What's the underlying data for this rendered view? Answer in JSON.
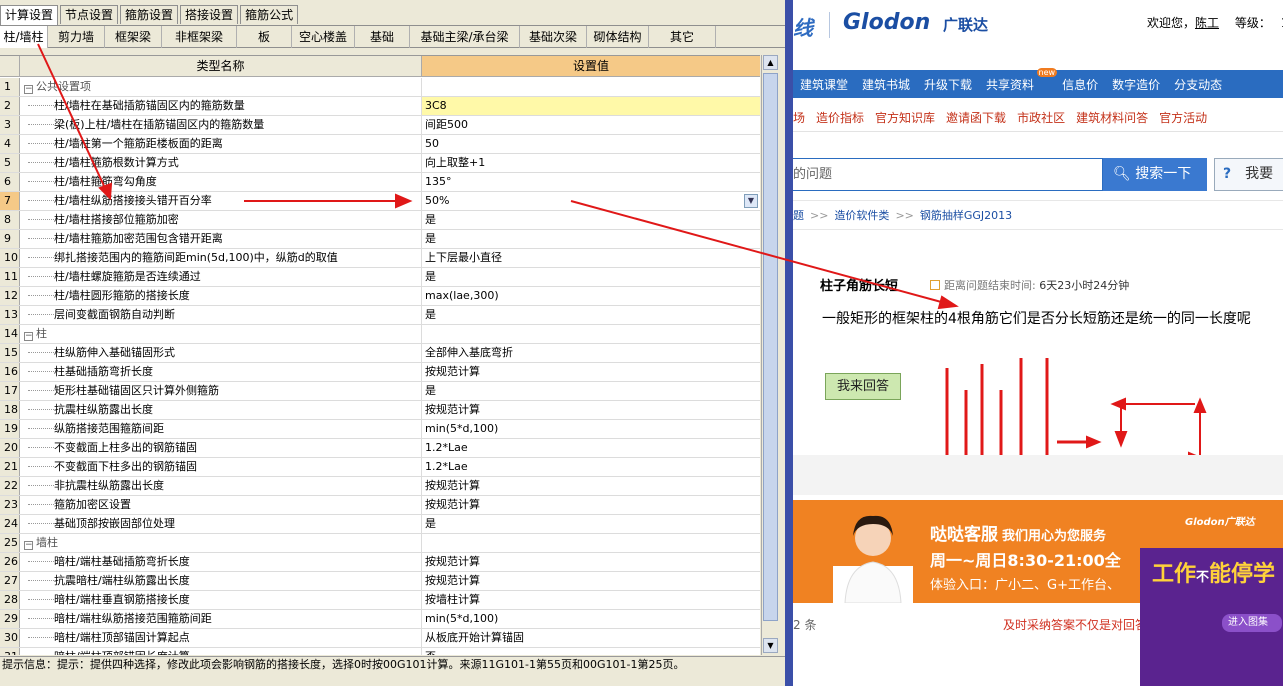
{
  "left": {
    "top_tabs": [
      "计算设置",
      "节点设置",
      "箍筋设置",
      "搭接设置",
      "箍筋公式"
    ],
    "active_top_tab": 0,
    "sub_tabs": [
      "柱/墙柱",
      "剪力墙",
      "框架梁",
      "非框架梁",
      "板",
      "空心楼盖",
      "基础",
      "基础主梁/承台梁",
      "基础次梁",
      "砌体结构",
      "其它"
    ],
    "active_sub_tab": 0,
    "grid": {
      "col_name": "类型名称",
      "col_value": "设置值",
      "rows": [
        {
          "num": "1",
          "name": "公共设置项",
          "value": "",
          "group": true
        },
        {
          "num": "2",
          "name": "柱/墙柱在基础插筋锚固区内的箍筋数量",
          "value": "3C8",
          "highlight": true
        },
        {
          "num": "3",
          "name": "梁(板)上柱/墙柱在插筋锚固区内的箍筋数量",
          "value": "间距500"
        },
        {
          "num": "4",
          "name": "柱/墙柱第一个箍筋距楼板面的距离",
          "value": "50"
        },
        {
          "num": "5",
          "name": "柱/墙柱箍筋根数计算方式",
          "value": "向上取整+1"
        },
        {
          "num": "6",
          "name": "柱/墙柱箍筋弯勾角度",
          "value": "135°"
        },
        {
          "num": "7",
          "name": "柱/墙柱纵筋搭接接头错开百分率",
          "value": "50%",
          "selected": true
        },
        {
          "num": "8",
          "name": "柱/墙柱搭接部位箍筋加密",
          "value": "是"
        },
        {
          "num": "9",
          "name": "柱/墙柱箍筋加密范围包含错开距离",
          "value": "是"
        },
        {
          "num": "10",
          "name": "绑扎搭接范围内的箍筋间距min(5d,100)中，纵筋d的取值",
          "value": "上下层最小直径"
        },
        {
          "num": "11",
          "name": "柱/墙柱螺旋箍筋是否连续通过",
          "value": "是"
        },
        {
          "num": "12",
          "name": "柱/墙柱圆形箍筋的搭接长度",
          "value": "max(lae,300)"
        },
        {
          "num": "13",
          "name": "层间变截面钢筋自动判断",
          "value": "是"
        },
        {
          "num": "14",
          "name": "柱",
          "value": "",
          "group": true
        },
        {
          "num": "15",
          "name": "柱纵筋伸入基础锚固形式",
          "value": "全部伸入基底弯折"
        },
        {
          "num": "16",
          "name": "柱基础插筋弯折长度",
          "value": "按规范计算"
        },
        {
          "num": "17",
          "name": "矩形柱基础锚固区只计算外侧箍筋",
          "value": "是"
        },
        {
          "num": "18",
          "name": "抗震柱纵筋露出长度",
          "value": "按规范计算"
        },
        {
          "num": "19",
          "name": "纵筋搭接范围箍筋间距",
          "value": "min(5*d,100)"
        },
        {
          "num": "20",
          "name": "不变截面上柱多出的钢筋锚固",
          "value": "1.2*Lae"
        },
        {
          "num": "21",
          "name": "不变截面下柱多出的钢筋锚固",
          "value": "1.2*Lae"
        },
        {
          "num": "22",
          "name": "非抗震柱纵筋露出长度",
          "value": "按规范计算"
        },
        {
          "num": "23",
          "name": "箍筋加密区设置",
          "value": "按规范计算"
        },
        {
          "num": "24",
          "name": "基础顶部按嵌固部位处理",
          "value": "是"
        },
        {
          "num": "25",
          "name": "墙柱",
          "value": "",
          "group": true
        },
        {
          "num": "26",
          "name": "暗柱/端柱基础插筋弯折长度",
          "value": "按规范计算"
        },
        {
          "num": "27",
          "name": "抗震暗柱/端柱纵筋露出长度",
          "value": "按规范计算"
        },
        {
          "num": "28",
          "name": "暗柱/端柱垂直钢筋搭接长度",
          "value": "按墙柱计算"
        },
        {
          "num": "29",
          "name": "暗柱/端柱纵筋搭接范围箍筋间距",
          "value": "min(5*d,100)"
        },
        {
          "num": "30",
          "name": "暗柱/端柱顶部锚固计算起点",
          "value": "从板底开始计算锚固"
        },
        {
          "num": "31",
          "name": "暗柱/端柱顶部锚固长度计算",
          "value": "否"
        }
      ]
    },
    "status": "提示信息：提示：提供四种选择，修改此项会影响钢筋的搭接长度，选择0时按00G101计算。来源11G101-1第55页和00G101-1第25页。"
  },
  "right": {
    "logo_prefix": "线",
    "logo": "Glodon",
    "logo_cn": "广联达",
    "welcome": "欢迎您，",
    "user": "陈工",
    "level": "等级：",
    "level_value": "1",
    "nav": [
      "建筑课堂",
      "建筑书城",
      "升级下载",
      "共享资料",
      "信息价",
      "数字造价",
      "分支动态"
    ],
    "new_badge": "new",
    "sub_nav": [
      "场",
      "造价指标",
      "官方知识库",
      "邀请函下载",
      "市政社区",
      "建筑材料问答",
      "官方活动"
    ],
    "search_text": "的问题",
    "search_button": "搜索一下",
    "ask_button": "我要",
    "ask_mark": "?",
    "breadcrumb": [
      "题",
      "造价软件类",
      "钢筋抽样GGJ2013"
    ],
    "breadcrumb_sep": ">>",
    "question_title": "柱子角筋长短",
    "timer_label": "距离问题结束时间:",
    "timer_value": "6天23小时24分钟",
    "question_body": "一般矩形的框架柱的4根角筋它们是否分长短筋还是统一的同一长度呢",
    "answer_button": "我来回答",
    "banner": {
      "line1": "哒哒客服",
      "line1b": "我们用心为您服务",
      "line2": "周一~周日8:30-21:00全",
      "line3": "体验入口：广小二、G+工作台、",
      "logo": "Glodon广联达"
    },
    "pager_count": "2 条",
    "pager_tip": "及时采纳答案不仅是对回答",
    "popup": {
      "title": "工作",
      "title_small": "不",
      "title2": "能停学",
      "button": "进入图集"
    }
  }
}
